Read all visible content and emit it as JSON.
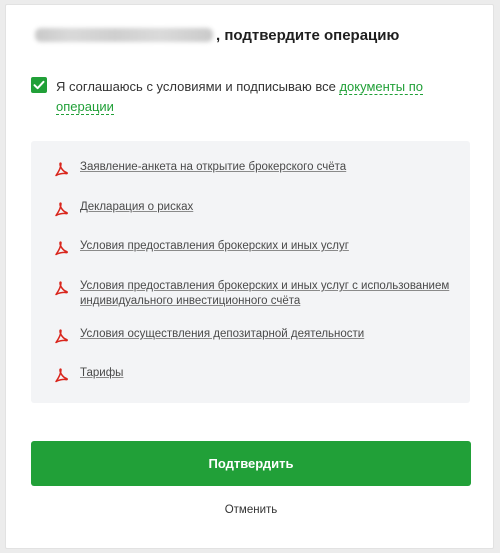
{
  "header": {
    "title_suffix": ", подтвердите операцию"
  },
  "consent": {
    "checked": true,
    "text": "Я соглашаюсь с условиями и подписываю все ",
    "link_text": "документы по операции"
  },
  "documents": [
    {
      "label": "Заявление-анкета на открытие брокерского счёта",
      "icon": "pdf-icon"
    },
    {
      "label": "Декларация о рисках",
      "icon": "pdf-icon"
    },
    {
      "label": "Условия предоставления брокерских и иных услуг",
      "icon": "pdf-icon"
    },
    {
      "label": "Условия предоставления брокерских и иных услуг с использованием индивидуального инвестиционного счёта",
      "icon": "pdf-icon"
    },
    {
      "label": "Условия осуществления депозитарной деятельности",
      "icon": "pdf-icon"
    },
    {
      "label": "Тарифы",
      "icon": "pdf-icon"
    }
  ],
  "actions": {
    "confirm_label": "Подтвердить",
    "cancel_label": "Отменить"
  },
  "colors": {
    "accent": "#21a038",
    "pdf_icon": "#d9251c",
    "panel_bg": "#f3f4f6"
  }
}
